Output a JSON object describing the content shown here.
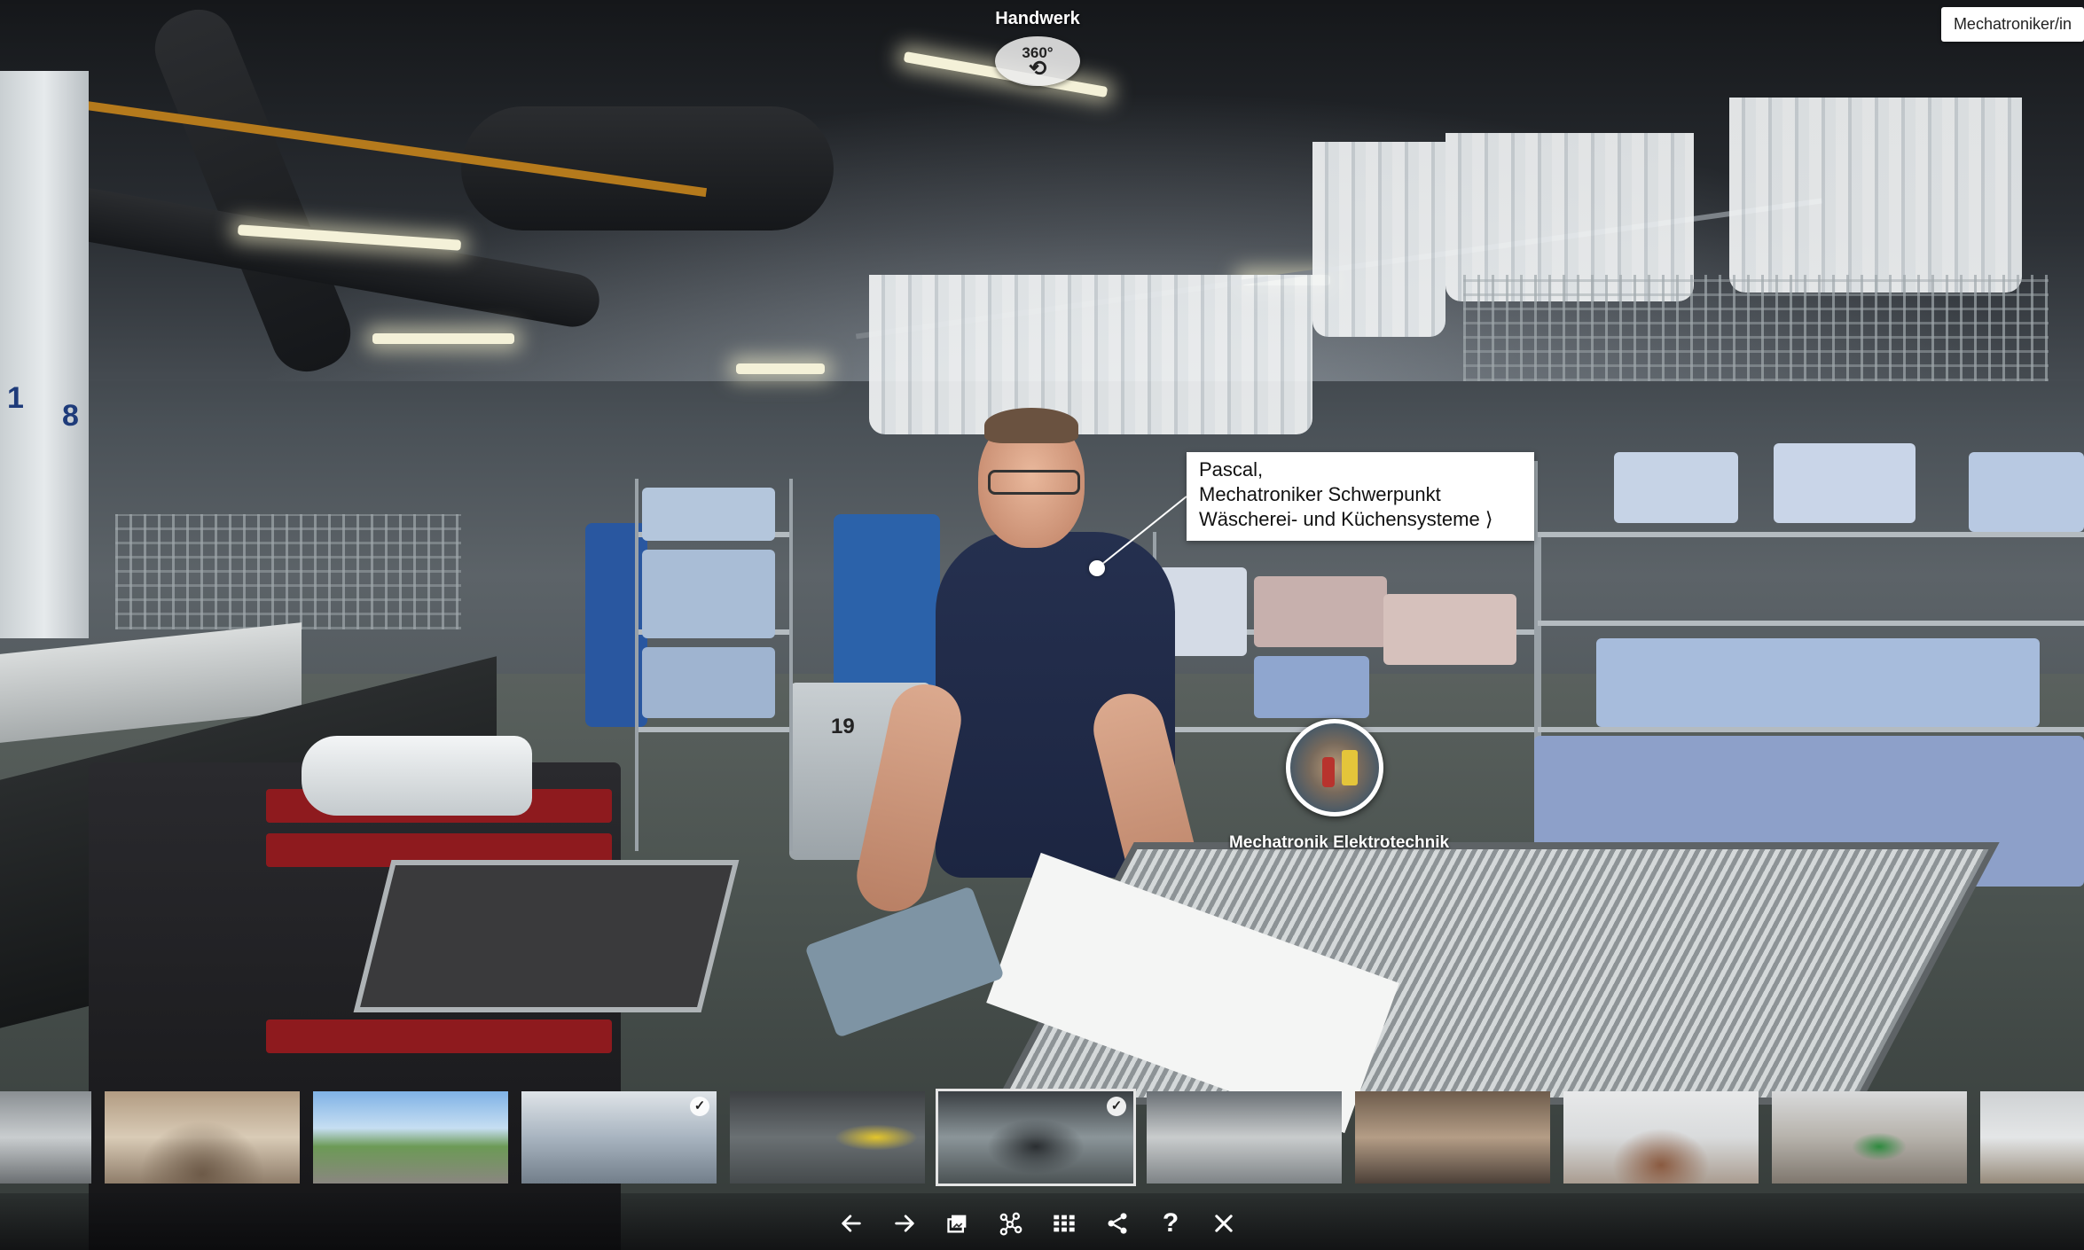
{
  "hotspots": {
    "top": {
      "label": "Handwerk",
      "badge": "360°"
    },
    "scene": {
      "label": "Mechatronik Elektrotechnik"
    }
  },
  "top_right": {
    "label": "Mechatroniker/in"
  },
  "info": {
    "line1": "Pascal,",
    "line2": "Mechatroniker Schwerpunkt",
    "line3": "Wäscherei- und Küchensysteme ⟩"
  },
  "scene": {
    "shelf_number": "19",
    "wall_numbers": [
      "1",
      "8"
    ]
  },
  "thumbnails": [
    {
      "name": "thumb-1",
      "check": ""
    },
    {
      "name": "thumb-2",
      "check": ""
    },
    {
      "name": "thumb-3",
      "check": ""
    },
    {
      "name": "thumb-4",
      "check": "✓"
    },
    {
      "name": "thumb-5",
      "check": ""
    },
    {
      "name": "thumb-6",
      "check": "✓"
    },
    {
      "name": "thumb-7",
      "check": ""
    },
    {
      "name": "thumb-8",
      "check": ""
    },
    {
      "name": "thumb-9",
      "check": ""
    },
    {
      "name": "thumb-10",
      "check": ""
    },
    {
      "name": "thumb-11",
      "check": ""
    }
  ],
  "active_thumbnail": 6,
  "toolbar": {
    "icons": [
      "arrow-left-icon",
      "arrow-right-icon",
      "gallery-icon",
      "scene-map-icon",
      "grid-icon",
      "share-icon",
      "help-icon",
      "close-icon"
    ],
    "help_glyph": "?"
  }
}
